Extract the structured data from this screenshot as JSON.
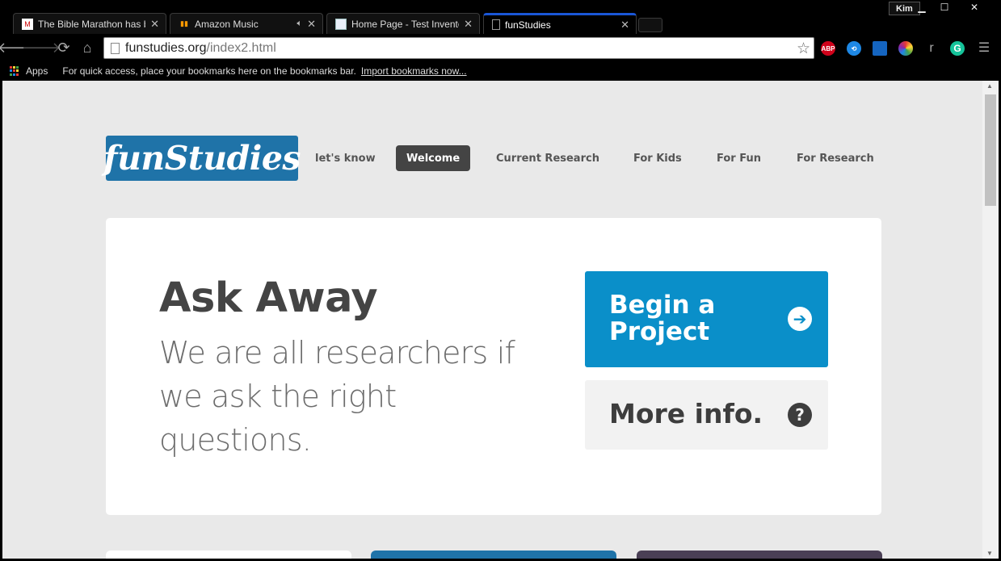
{
  "browser": {
    "tabs": [
      {
        "title": "The Bible Marathon has b",
        "favicon": "gmail-icon",
        "active": false,
        "audio": false
      },
      {
        "title": "Amazon Music",
        "favicon": "amazon-music-icon",
        "active": false,
        "audio": true
      },
      {
        "title": "Home Page - Test Invento",
        "favicon": "docs-icon",
        "active": false,
        "audio": false
      },
      {
        "title": "funStudies",
        "favicon": "page-icon",
        "active": true,
        "audio": false
      }
    ],
    "profile_name": "Kim",
    "address": {
      "host": "funstudies.org",
      "path": "/index2.html"
    },
    "extensions": [
      {
        "name": "adblock-plus-icon",
        "label": "ABP",
        "color": "#d0021b"
      },
      {
        "name": "sync-extension-icon",
        "label": "",
        "color": "#1e88e5"
      },
      {
        "name": "clipboard-extension-icon",
        "label": "",
        "color": "#1565c0"
      },
      {
        "name": "color-wheel-icon",
        "label": "",
        "color": "#e53935"
      },
      {
        "name": "r-extension-icon",
        "label": "r",
        "color": "#000000"
      },
      {
        "name": "grammarly-icon",
        "label": "",
        "color": "#15c39a"
      }
    ],
    "bookmarks_bar": {
      "apps_label": "Apps",
      "hint": "For quick access, place your bookmarks here on the bookmarks bar.",
      "import_link": "Import bookmarks now..."
    }
  },
  "site": {
    "logo": "funStudies",
    "brand_color": "#1f73a8",
    "nav": [
      {
        "label": "let's know",
        "active": false
      },
      {
        "label": "Welcome",
        "active": true
      },
      {
        "label": "Current Research",
        "active": false
      },
      {
        "label": "For Kids",
        "active": false
      },
      {
        "label": "For Fun",
        "active": false
      },
      {
        "label": "For Research",
        "active": false
      }
    ],
    "hero": {
      "title": "Ask Away",
      "subtitle": "We are all researchers if we ask the right questions.",
      "primary_button": "Begin a Project",
      "secondary_button": "More info."
    },
    "colors": {
      "primary_button": "#0a8fc9",
      "secondary_button": "#f2f2f2",
      "active_nav": "#444444"
    }
  }
}
